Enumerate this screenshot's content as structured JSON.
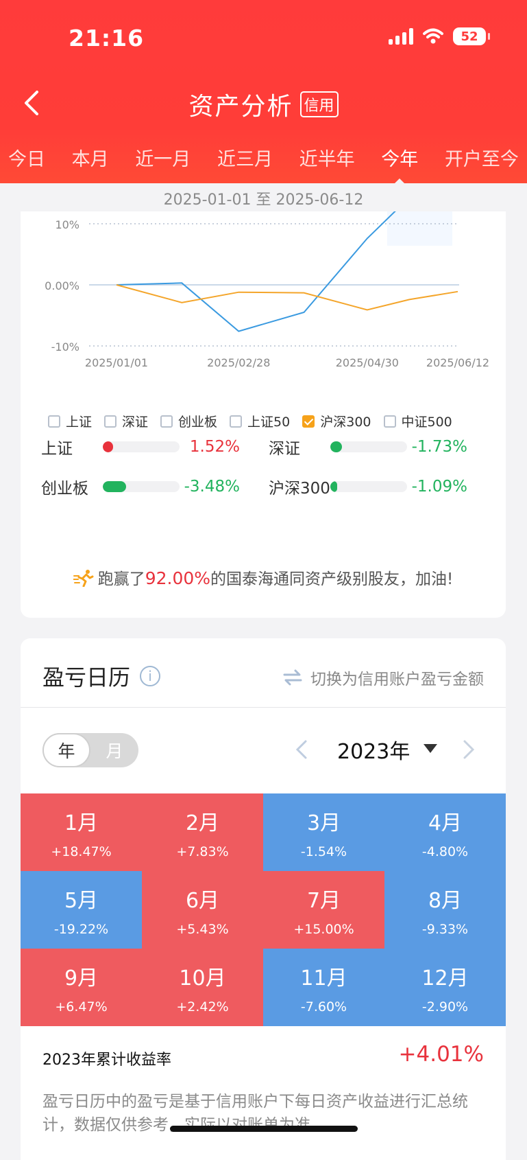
{
  "status": {
    "time": "21:16",
    "battery": "52"
  },
  "header": {
    "title": "资产分析",
    "badge": "信用"
  },
  "tabs": [
    {
      "label": "今日",
      "active": false
    },
    {
      "label": "本月",
      "active": false
    },
    {
      "label": "近一月",
      "active": false
    },
    {
      "label": "近三月",
      "active": false
    },
    {
      "label": "近半年",
      "active": false
    },
    {
      "label": "今年",
      "active": true
    },
    {
      "label": "开户至今",
      "active": false
    }
  ],
  "date_range": "2025-01-01 至 2025-06-12",
  "chart_data": {
    "type": "line",
    "y_ticks": [
      "10%",
      "0.00%",
      "-10%"
    ],
    "ylim": [
      -10,
      10
    ],
    "x_ticks": [
      "2025/01/01",
      "2025/02/28",
      "2025/04/30",
      "2025/06/12"
    ],
    "series": [
      {
        "color": "#3a9ae0",
        "x": [
          "2025/01/01",
          "2025/02/01",
          "2025/02/28",
          "2025/03/31",
          "2025/04/30",
          "2025/05/20"
        ],
        "values": [
          0.0,
          0.3,
          -7.6,
          -4.5,
          7.6,
          14.3
        ]
      },
      {
        "color": "#f4a52a",
        "x": [
          "2025/01/01",
          "2025/02/01",
          "2025/02/28",
          "2025/03/31",
          "2025/04/30",
          "2025/05/20",
          "2025/06/12"
        ],
        "values": [
          0.0,
          -2.9,
          -1.2,
          -1.3,
          -4.1,
          -2.4,
          -1.1
        ]
      }
    ]
  },
  "legend": [
    {
      "label": "上证",
      "checked": false
    },
    {
      "label": "深证",
      "checked": false
    },
    {
      "label": "创业板",
      "checked": false
    },
    {
      "label": "上证50",
      "checked": false
    },
    {
      "label": "沪深300",
      "checked": true
    },
    {
      "label": "中证500",
      "checked": false
    }
  ],
  "indices": [
    {
      "name": "上证",
      "value": "1.52%",
      "fraction": 0.13,
      "color": "#e8323c"
    },
    {
      "name": "深证",
      "value": "-1.73%",
      "fraction": 0.15,
      "color": "#22b35e"
    },
    {
      "name": "创业板",
      "value": "-3.48%",
      "fraction": 0.3,
      "color": "#22b35e"
    },
    {
      "name": "沪深300",
      "value": "-1.09%",
      "fraction": 0.09,
      "color": "#22b35e"
    }
  ],
  "motto": {
    "prefix": "跑赢了",
    "percent": "92.00%",
    "suffix": "的国泰海通同资产级别股友，加油!"
  },
  "calendar": {
    "title": "盈亏日历",
    "switch_label": "切换为信用账户盈亏金额",
    "toggle": {
      "year": "年",
      "month": "月"
    },
    "year": "2023年",
    "months": [
      {
        "m": "1月",
        "p": "+18.47%",
        "pos": true
      },
      {
        "m": "2月",
        "p": "+7.83%",
        "pos": true
      },
      {
        "m": "3月",
        "p": "-1.54%",
        "pos": false
      },
      {
        "m": "4月",
        "p": "-4.80%",
        "pos": false
      },
      {
        "m": "5月",
        "p": "-19.22%",
        "pos": false
      },
      {
        "m": "6月",
        "p": "+5.43%",
        "pos": true
      },
      {
        "m": "7月",
        "p": "+15.00%",
        "pos": true
      },
      {
        "m": "8月",
        "p": "-9.33%",
        "pos": false
      },
      {
        "m": "9月",
        "p": "+6.47%",
        "pos": true
      },
      {
        "m": "10月",
        "p": "+2.42%",
        "pos": true
      },
      {
        "m": "11月",
        "p": "-7.60%",
        "pos": false
      },
      {
        "m": "12月",
        "p": "-2.90%",
        "pos": false
      }
    ],
    "cum_label": "2023年累计收益率",
    "cum_value": "+4.01%",
    "note": "盈亏日历中的盈亏是基于信用账户下每日资产收益进行汇总统计，数据仅供参考，实际以对账单为准。"
  },
  "colors": {
    "positive": "#ef5b5f",
    "negative": "#5a9be3"
  }
}
